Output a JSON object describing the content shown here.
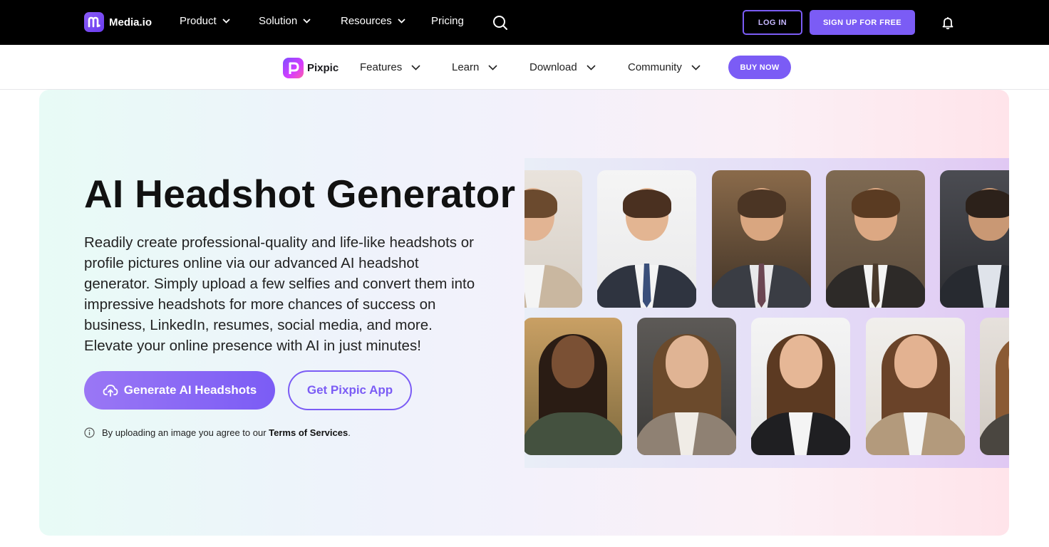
{
  "topnav": {
    "brand": "Media.io",
    "items": [
      {
        "label": "Product"
      },
      {
        "label": "Solution"
      },
      {
        "label": "Resources"
      },
      {
        "label": "Pricing"
      }
    ],
    "login_label": "LOG IN",
    "signup_label": "SIGN UP FOR FREE"
  },
  "subnav": {
    "brand": "Pixpic",
    "items": [
      {
        "label": "Features"
      },
      {
        "label": "Learn"
      },
      {
        "label": "Download"
      },
      {
        "label": "Community"
      }
    ],
    "buy_label": "BUY NOW"
  },
  "hero": {
    "title": "AI Headshot Generator",
    "description": "Readily create professional-quality and life-like headshots or profile pictures online via our advanced AI headshot generator. Simply upload a few selfies and convert them into impressive headshots for more chances of success on business, LinkedIn, resumes, social media, and more. Elevate your online presence with AI in just minutes!",
    "generate_label": "Generate AI Headshots",
    "app_label": "Get Pixpic App",
    "terms_prefix": "By uploading an image you agree to our ",
    "terms_link": "Terms of Services",
    "terms_suffix": "."
  },
  "colors": {
    "accent": "#7b5cf5",
    "topnav_bg": "#000000"
  }
}
